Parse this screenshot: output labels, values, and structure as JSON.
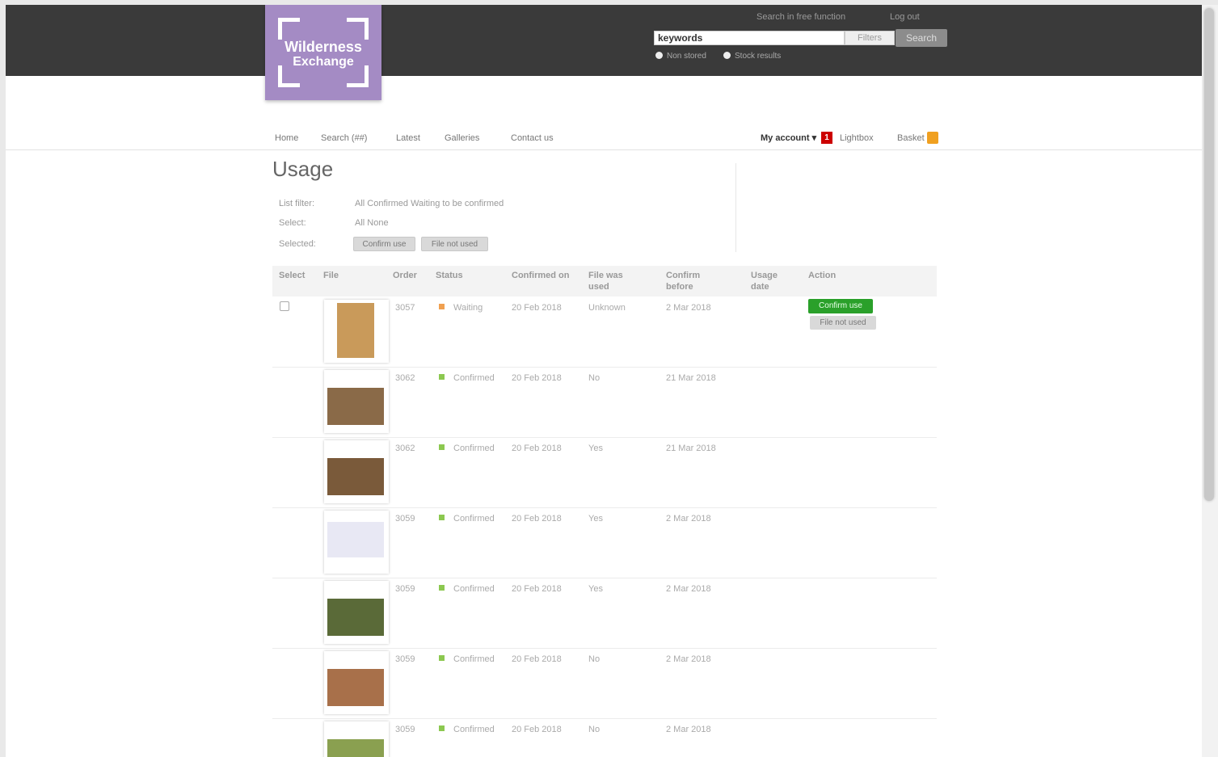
{
  "header": {
    "logo_line1": "Wilderness",
    "logo_line2": "Exchange",
    "top_links": [
      "Search in free function",
      "Log out"
    ],
    "search": {
      "value": "keywords",
      "filter_label": "Filters",
      "button_label": "Search"
    },
    "radios": [
      "Non stored",
      "Stock results"
    ]
  },
  "nav": {
    "items": [
      "Home",
      "Search (##)",
      "Latest",
      "Galleries",
      "Contact us"
    ],
    "my_account": "My account",
    "notification_count": "1",
    "lightbox": "Lightbox",
    "basket": "Basket"
  },
  "page": {
    "title": "Usage",
    "filters": {
      "list_filter_label": "List filter:",
      "list_filter_value": "All   Confirmed   Waiting to be confirmed",
      "select_label": "Select:",
      "select_value": "All   None",
      "selected_label": "Selected:",
      "confirm_use": "Confirm use",
      "file_not_used": "File not used"
    }
  },
  "table": {
    "headers": [
      "Select",
      "File",
      "Order",
      "Status",
      "Confirmed on",
      "File was used",
      "Confirm before",
      "Usage date",
      "Action"
    ],
    "rows": [
      {
        "order": "3057",
        "status": "Waiting",
        "status_color": "#f0a050",
        "confirmed_on": "20 Feb 2018",
        "used": "Unknown",
        "before": "2 Mar 2018",
        "selectable": true,
        "actions": [
          "Confirm use",
          "File not used"
        ],
        "thumb_color": "#c99a5a"
      },
      {
        "order": "3062",
        "status": "Confirmed",
        "status_color": "#8cc850",
        "confirmed_on": "20 Feb 2018",
        "used": "No",
        "before": "21 Mar 2018",
        "selectable": false,
        "actions": [],
        "thumb_color": "#8a6a48"
      },
      {
        "order": "3062",
        "status": "Confirmed",
        "status_color": "#8cc850",
        "confirmed_on": "20 Feb 2018",
        "used": "Yes",
        "before": "21 Mar 2018",
        "selectable": false,
        "actions": [],
        "thumb_color": "#7a5a3a"
      },
      {
        "order": "3059",
        "status": "Confirmed",
        "status_color": "#8cc850",
        "confirmed_on": "20 Feb 2018",
        "used": "Yes",
        "before": "2 Mar 2018",
        "selectable": false,
        "actions": [],
        "thumb_color": "#e8e8f4"
      },
      {
        "order": "3059",
        "status": "Confirmed",
        "status_color": "#8cc850",
        "confirmed_on": "20 Feb 2018",
        "used": "Yes",
        "before": "2 Mar 2018",
        "selectable": false,
        "actions": [],
        "thumb_color": "#5a6a38"
      },
      {
        "order": "3059",
        "status": "Confirmed",
        "status_color": "#8cc850",
        "confirmed_on": "20 Feb 2018",
        "used": "No",
        "before": "2 Mar 2018",
        "selectable": false,
        "actions": [],
        "thumb_color": "#a8704a"
      },
      {
        "order": "3059",
        "status": "Confirmed",
        "status_color": "#8cc850",
        "confirmed_on": "20 Feb 2018",
        "used": "No",
        "before": "2 Mar 2018",
        "selectable": false,
        "actions": [],
        "thumb_color": "#8aa050"
      }
    ]
  }
}
